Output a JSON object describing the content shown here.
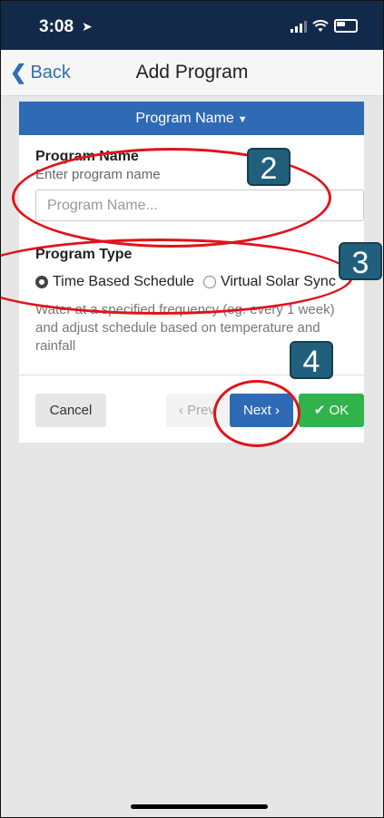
{
  "status_bar": {
    "time": "3:08"
  },
  "nav": {
    "back_label": "Back",
    "title": "Add Program"
  },
  "card": {
    "header_label": "Program Name",
    "program_name": {
      "label": "Program Name",
      "help": "Enter program name",
      "placeholder": "Program Name..."
    },
    "program_type": {
      "label": "Program Type",
      "options": [
        {
          "label": "Time Based Schedule",
          "selected": true
        },
        {
          "label": "Virtual Solar Sync",
          "selected": false
        }
      ],
      "description": "Water at a specified frequency (eg. every 1 week) and adjust schedule based on temperature and rainfall"
    },
    "buttons": {
      "cancel": "Cancel",
      "prev": "‹ Prev",
      "next": "Next ›",
      "ok": "OK"
    }
  },
  "annotations": {
    "markers": [
      "2",
      "3",
      "4"
    ],
    "color": "#e0131b"
  },
  "colors": {
    "status_bar_bg": "#13294a",
    "accent": "#2f6ab5",
    "ok_green": "#2fb34a",
    "badge_bg": "#20607d"
  }
}
